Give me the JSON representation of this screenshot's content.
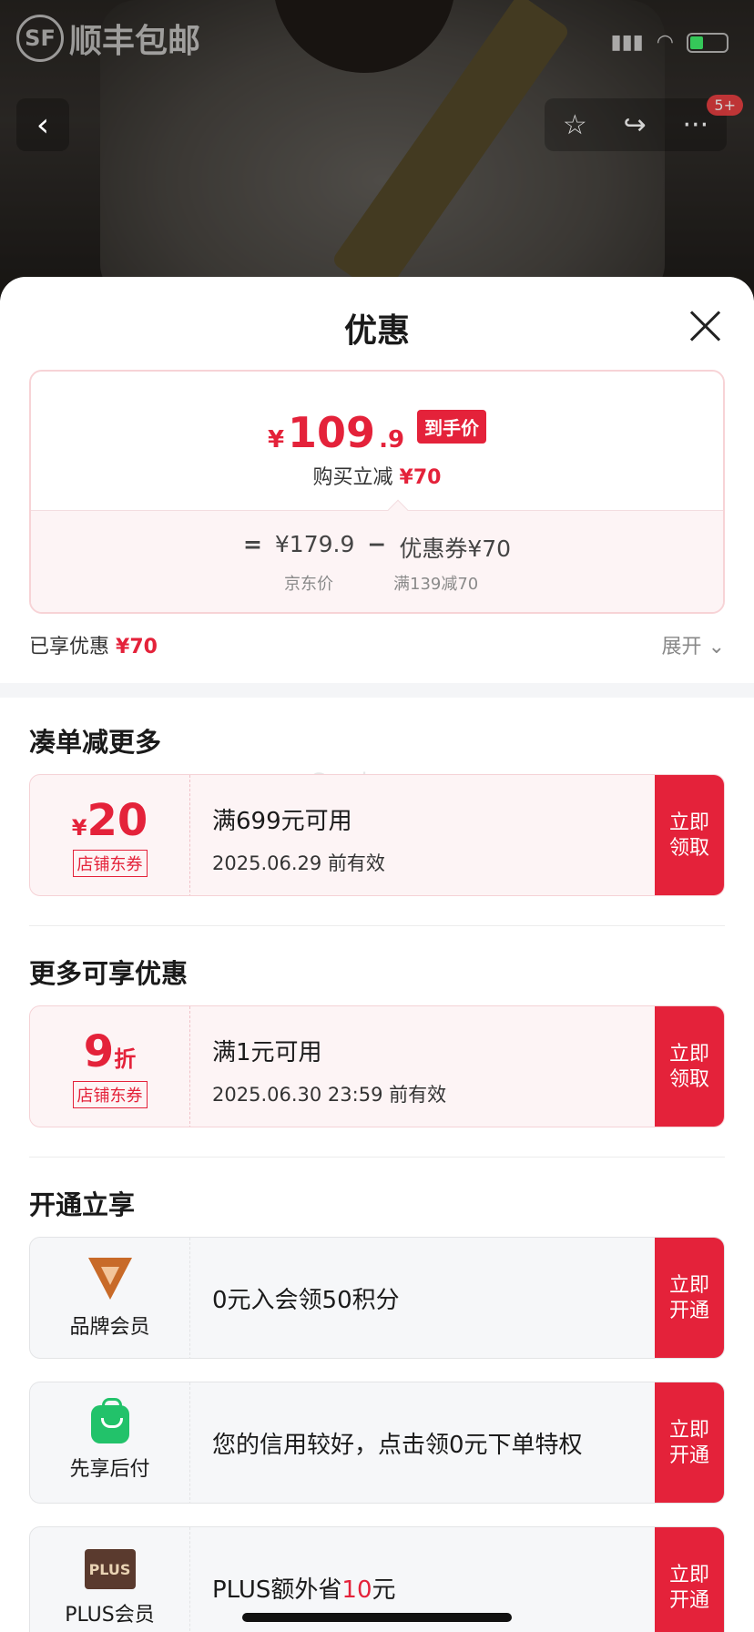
{
  "status_bar": {
    "carrier_logo": "顺丰包邮",
    "sf_mark": "SF",
    "battery_color": "#35c759"
  },
  "nav": {
    "back_icon": "chevron-left-icon",
    "badge": "5+"
  },
  "sheet": {
    "title": "优惠",
    "close_icon": "close-icon",
    "price_card": {
      "yen": "¥",
      "price_main": "109",
      "price_decimal": ".9",
      "price_tag": "到手价",
      "reduce_label": "购买立减",
      "reduce_value": "¥70",
      "formula_eq": "=",
      "formula_price": "¥179.9",
      "formula_minus": "−",
      "formula_coupon": "优惠券¥70",
      "label_price": "京东价",
      "label_coupon": "满139减70"
    },
    "enjoyed_label": "已享优惠",
    "enjoyed_value": "¥70",
    "expand_label": "展开"
  },
  "sections": {
    "more_orders": {
      "title": "凑单减更多"
    },
    "more_offers": {
      "title": "更多可享优惠"
    },
    "membership": {
      "title": "开通立享"
    }
  },
  "coupons": [
    {
      "amount_prefix": "¥",
      "amount": "20",
      "tag": "店铺东券",
      "condition": "满699元可用",
      "validity": "2025.06.29 前有效",
      "action": "立即领取"
    },
    {
      "amount": "9",
      "amount_suffix": "折",
      "tag": "店铺东券",
      "condition": "满1元可用",
      "validity": "2025.06.30 23:59 前有效",
      "action": "立即领取"
    }
  ],
  "memberships": [
    {
      "label": "品牌会员",
      "text": "0元入会领50积分",
      "action": "立即开通"
    },
    {
      "label": "先享后付",
      "text": "您的信用较好，点击领0元下单特权",
      "action": "立即开通"
    },
    {
      "label": "PLUS会员",
      "icon_text": "PLUS",
      "text_pre": "PLUS额外省",
      "text_red": "10",
      "text_post": "元",
      "action": "立即开通"
    }
  ],
  "watermark": "Gemine",
  "colors": {
    "accent": "#e4223a",
    "coupon_bg": "#fdf4f5",
    "grey_bg": "#f6f7f9"
  }
}
